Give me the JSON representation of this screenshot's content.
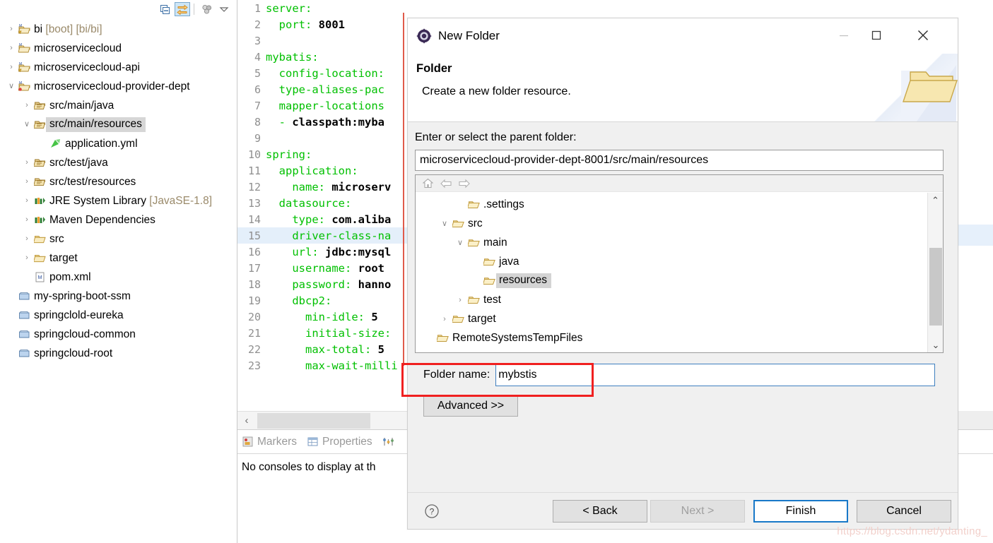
{
  "explorer": {
    "toolbar": [
      {
        "name": "collapse-all-icon",
        "label": "Collapse All"
      },
      {
        "name": "link-with-editor-icon",
        "label": "Link with Editor",
        "active": true
      },
      {
        "name": "view-menu-icon",
        "label": "View Menu"
      },
      {
        "name": "chevron-down-icon",
        "label": "Minimize"
      }
    ],
    "tree": [
      {
        "label": "bi",
        "suffix": " [boot] [bi/bi]",
        "twist": "›",
        "icon": "maven-project-warning-icon",
        "indent": 0,
        "selected": false
      },
      {
        "label": "microservicecloud",
        "suffix": "",
        "twist": "›",
        "icon": "maven-project-icon",
        "indent": 0,
        "selected": false
      },
      {
        "label": "microservicecloud-api",
        "suffix": "",
        "twist": "›",
        "icon": "maven-project-warning-icon",
        "indent": 0,
        "selected": false
      },
      {
        "label": "microservicecloud-provider-dept",
        "suffix": "",
        "twist": "∨",
        "icon": "maven-project-error-icon",
        "indent": 0,
        "selected": false
      },
      {
        "label": "src/main/java",
        "suffix": "",
        "twist": "›",
        "icon": "source-folder-icon",
        "indent": 1,
        "selected": false
      },
      {
        "label": "src/main/resources",
        "suffix": "",
        "twist": "∨",
        "icon": "source-folder-icon",
        "indent": 1,
        "selected": true
      },
      {
        "label": "application.yml",
        "suffix": "",
        "twist": "",
        "icon": "yml-file-icon",
        "indent": 2,
        "selected": false
      },
      {
        "label": "src/test/java",
        "suffix": "",
        "twist": "›",
        "icon": "source-folder-icon",
        "indent": 1,
        "selected": false
      },
      {
        "label": "src/test/resources",
        "suffix": "",
        "twist": "›",
        "icon": "source-folder-icon",
        "indent": 1,
        "selected": false
      },
      {
        "label": "JRE System Library",
        "suffix": " [JavaSE-1.8]",
        "twist": "›",
        "icon": "library-icon",
        "indent": 1,
        "selected": false
      },
      {
        "label": "Maven Dependencies",
        "suffix": "",
        "twist": "›",
        "icon": "library-icon",
        "indent": 1,
        "selected": false
      },
      {
        "label": "src",
        "suffix": "",
        "twist": "›",
        "icon": "folder-icon",
        "indent": 1,
        "selected": false
      },
      {
        "label": "target",
        "suffix": "",
        "twist": "›",
        "icon": "folder-icon",
        "indent": 1,
        "selected": false
      },
      {
        "label": "pom.xml",
        "suffix": "",
        "twist": "",
        "icon": "xml-file-icon",
        "indent": 1,
        "selected": false
      },
      {
        "label": "my-spring-boot-ssm",
        "suffix": "",
        "twist": "",
        "icon": "closed-project-icon",
        "indent": 0,
        "selected": false
      },
      {
        "label": "springclold-eureka",
        "suffix": "",
        "twist": "",
        "icon": "closed-project-icon",
        "indent": 0,
        "selected": false
      },
      {
        "label": "springcloud-common",
        "suffix": "",
        "twist": "",
        "icon": "closed-project-icon",
        "indent": 0,
        "selected": false
      },
      {
        "label": "springcloud-root",
        "suffix": "",
        "twist": "",
        "icon": "closed-project-icon",
        "indent": 0,
        "selected": false
      }
    ]
  },
  "editor": {
    "lines": [
      {
        "n": "1",
        "indent": 0,
        "key": "server:",
        "value": "",
        "hl": false
      },
      {
        "n": "2",
        "indent": 1,
        "key": "port:",
        "value": " 8001",
        "hl": false
      },
      {
        "n": "3",
        "indent": 0,
        "key": "",
        "value": "",
        "hl": false
      },
      {
        "n": "4",
        "indent": 0,
        "key": "mybatis:",
        "value": "",
        "hl": false
      },
      {
        "n": "5",
        "indent": 1,
        "key": "config-location:",
        "value": "",
        "hl": false
      },
      {
        "n": "6",
        "indent": 1,
        "key": "type-aliases-pac",
        "value": "",
        "hl": false
      },
      {
        "n": "7",
        "indent": 1,
        "key": "mapper-locations",
        "value": "",
        "hl": false
      },
      {
        "n": "8",
        "indent": 1,
        "key": "-",
        "value": " classpath:myba",
        "hl": false
      },
      {
        "n": "9",
        "indent": 0,
        "key": "",
        "value": "",
        "hl": false
      },
      {
        "n": "10",
        "indent": 0,
        "key": "spring:",
        "value": "",
        "hl": false
      },
      {
        "n": "11",
        "indent": 1,
        "key": "application:",
        "value": "",
        "hl": false
      },
      {
        "n": "12",
        "indent": 2,
        "key": "name:",
        "value": " microserv",
        "hl": false
      },
      {
        "n": "13",
        "indent": 1,
        "key": "datasource:",
        "value": "",
        "hl": false
      },
      {
        "n": "14",
        "indent": 2,
        "key": "type:",
        "value": " com.aliba",
        "hl": false
      },
      {
        "n": "15",
        "indent": 2,
        "key": "driver-class-na",
        "value": "",
        "hl": true
      },
      {
        "n": "16",
        "indent": 2,
        "key": "url:",
        "value": " jdbc:mysql",
        "hl": false
      },
      {
        "n": "17",
        "indent": 2,
        "key": "username:",
        "value": " root",
        "hl": false
      },
      {
        "n": "18",
        "indent": 2,
        "key": "password:",
        "value": " hanno",
        "hl": false
      },
      {
        "n": "19",
        "indent": 2,
        "key": "dbcp2:",
        "value": "",
        "hl": false
      },
      {
        "n": "20",
        "indent": 3,
        "key": "min-idle:",
        "value": " 5",
        "hl": false
      },
      {
        "n": "21",
        "indent": 3,
        "key": "initial-size:",
        "value": "",
        "hl": false
      },
      {
        "n": "22",
        "indent": 3,
        "key": "max-total:",
        "value": " 5",
        "hl": false
      },
      {
        "n": "23",
        "indent": 3,
        "key": "max-wait-milli",
        "value": "",
        "hl": false
      }
    ]
  },
  "console": {
    "tabs": [
      {
        "label": "Markers",
        "icon": "markers-icon"
      },
      {
        "label": "Properties",
        "icon": "properties-icon"
      },
      {
        "label": "",
        "icon": "servers-icon"
      }
    ],
    "message": "No consoles to display at th"
  },
  "dialog": {
    "window_title": "New Folder",
    "window_icon": "eclipse-wizard-icon",
    "window_buttons": {
      "minimize": "minimize-icon",
      "maximize": "maximize-icon",
      "close": "close-icon"
    },
    "header_title": "Folder",
    "header_desc": "Create a new folder resource.",
    "header_icon": "folder-banner-icon",
    "parent_label": "Enter or select the parent folder:",
    "parent_value": "microservicecloud-provider-dept-8001/src/main/resources",
    "parent_placeholder": "",
    "nav_icons": [
      {
        "name": "home-icon"
      },
      {
        "name": "back-arrow-icon"
      },
      {
        "name": "forward-arrow-icon"
      }
    ],
    "folder_tree": [
      {
        "label": ".settings",
        "twist": "",
        "indent": 1,
        "selected": false
      },
      {
        "label": "src",
        "twist": "∨",
        "indent": 0,
        "selected": false
      },
      {
        "label": "main",
        "twist": "∨",
        "indent": 1,
        "selected": false
      },
      {
        "label": "java",
        "twist": "",
        "indent": 2,
        "selected": false
      },
      {
        "label": "resources",
        "twist": "",
        "indent": 2,
        "selected": true
      },
      {
        "label": "test",
        "twist": "›",
        "indent": 1,
        "selected": false
      },
      {
        "label": "target",
        "twist": "›",
        "indent": 0,
        "selected": false
      },
      {
        "label": "RemoteSystemsTempFiles",
        "twist": "",
        "indent": -1,
        "selected": false
      }
    ],
    "scroll_up_icon": "chevron-up-icon",
    "scroll_down_icon": "chevron-down-icon",
    "foldername_label": "Folder name:",
    "foldername_value": "mybstis",
    "foldername_placeholder": "",
    "advanced_label": "Advanced >>",
    "help_icon": "help-icon",
    "buttons": {
      "back": "< Back",
      "next": "Next >",
      "finish": "Finish",
      "cancel": "Cancel"
    }
  },
  "watermark": "https://blog.csdn.net/ydanting_",
  "colors": {
    "accent": "#1878c8",
    "annotation": "#f02020",
    "yaml_key": "#00c000",
    "selection": "#d6d6d6",
    "current_line": "#e4effa"
  }
}
